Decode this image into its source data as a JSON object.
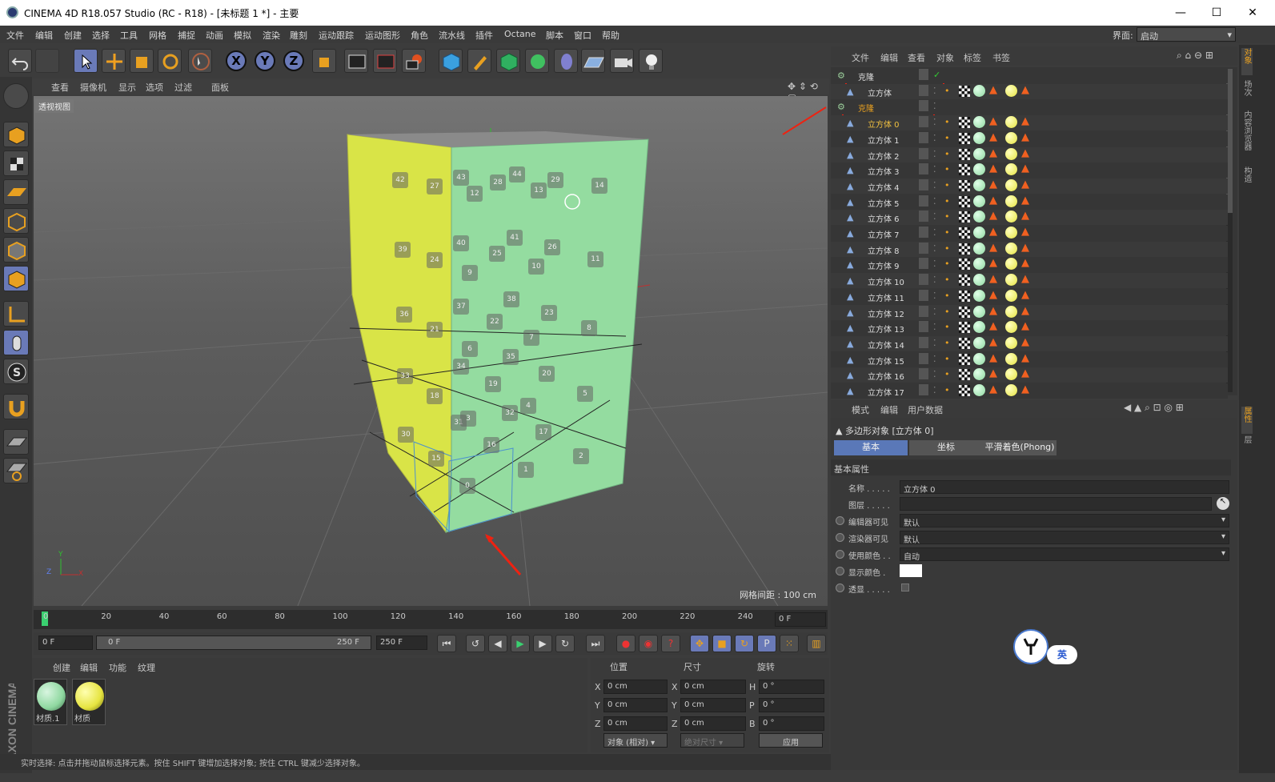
{
  "title": "CINEMA 4D R18.057 Studio (RC - R18) - [未标题 1 *] - 主要",
  "menu": [
    "文件",
    "编辑",
    "创建",
    "选择",
    "工具",
    "网格",
    "捕捉",
    "动画",
    "模拟",
    "渲染",
    "雕刻",
    "运动跟踪",
    "运动图形",
    "角色",
    "流水线",
    "插件",
    "Octane",
    "脚本",
    "窗口",
    "帮助"
  ],
  "layout": {
    "label": "界面:",
    "value": "启动"
  },
  "axes": [
    "X",
    "Y",
    "Z"
  ],
  "viewport": {
    "menu": [
      "查看",
      "摄像机",
      "显示",
      "选项",
      "过滤",
      "面板"
    ],
    "label": "透视视图",
    "grid": "网格间距 : 100 cm",
    "axis_y": "Y",
    "axis_z": "Z",
    "axis_x": "X"
  },
  "timeline": {
    "ticks": [
      "0",
      "20",
      "40",
      "60",
      "80",
      "100",
      "120",
      "140",
      "160",
      "180",
      "200",
      "220",
      "240"
    ],
    "current": "0 F"
  },
  "controls": {
    "start": "0 F",
    "range_start": "0 F",
    "range_end": "250 F",
    "end": "250 F"
  },
  "materials": {
    "menu": [
      "创建",
      "编辑",
      "功能",
      "纹理"
    ],
    "items": [
      {
        "name": "材质.1",
        "color": "#8fd8a0"
      },
      {
        "name": "材质",
        "color": "#e6e440"
      }
    ]
  },
  "coords": {
    "headers": [
      "位置",
      "尺寸",
      "旋转"
    ],
    "rows": [
      {
        "a": "X",
        "p": "0 cm",
        "b": "X",
        "s": "0 cm",
        "c": "H",
        "r": "0 °"
      },
      {
        "a": "Y",
        "p": "0 cm",
        "b": "Y",
        "s": "0 cm",
        "c": "P",
        "r": "0 °"
      },
      {
        "a": "Z",
        "p": "0 cm",
        "b": "Z",
        "s": "0 cm",
        "c": "B",
        "r": "0 °"
      }
    ],
    "mode": "对象 (相对)",
    "size_mode": "绝对尺寸",
    "apply": "应用"
  },
  "status": "实时选择: 点击并拖动鼠标选择元素。按住 SHIFT 键增加选择对象; 按住 CTRL 键减少选择对象。",
  "objects": {
    "menu": [
      "文件",
      "编辑",
      "查看",
      "对象",
      "标签",
      "书签"
    ],
    "rows": [
      "克隆",
      "立方体",
      "克隆",
      "立方体 0",
      "立方体 1",
      "立方体 2",
      "立方体 3",
      "立方体 4",
      "立方体 5",
      "立方体 6",
      "立方体 7",
      "立方体 8",
      "立方体 9",
      "立方体 10",
      "立方体 11",
      "立方体 12",
      "立方体 13",
      "立方体 14",
      "立方体 15",
      "立方体 16",
      "立方体 17"
    ]
  },
  "attributes": {
    "menu": [
      "模式",
      "编辑",
      "用户数据"
    ],
    "title": "多边形对象 [立方体 0]",
    "tabs": [
      "基本",
      "坐标",
      "平滑着色(Phong)"
    ],
    "section": "基本属性",
    "fields": [
      {
        "label": "名称 . . . . .",
        "value": "立方体 0"
      },
      {
        "label": "图层 . . . . .",
        "value": ""
      },
      {
        "label": "编辑器可见",
        "value": "默认"
      },
      {
        "label": "渲染器可见",
        "value": "默认"
      },
      {
        "label": "使用颜色 . .",
        "value": "自动"
      },
      {
        "label": "显示颜色 .",
        "value": ""
      },
      {
        "label": "透显 . . . . .",
        "value": ""
      }
    ]
  },
  "right_tabs": [
    "对象",
    "场次",
    "内容浏览器",
    "构造",
    "属性",
    "层"
  ],
  "ime": "英",
  "logo": "MAXON CINEMA 4D",
  "cube_numbers": [
    "42",
    "27",
    "43",
    "12",
    "28",
    "44",
    "13",
    "29",
    "14",
    "39",
    "24",
    "40",
    "25",
    "41",
    "9",
    "10",
    "26",
    "11",
    "36",
    "21",
    "37",
    "22",
    "38",
    "7",
    "23",
    "8",
    "33",
    "18",
    "34",
    "6",
    "35",
    "19",
    "20",
    "4",
    "5",
    "30",
    "15",
    "31",
    "3",
    "32",
    "16",
    "17",
    "0",
    "1",
    "2"
  ]
}
